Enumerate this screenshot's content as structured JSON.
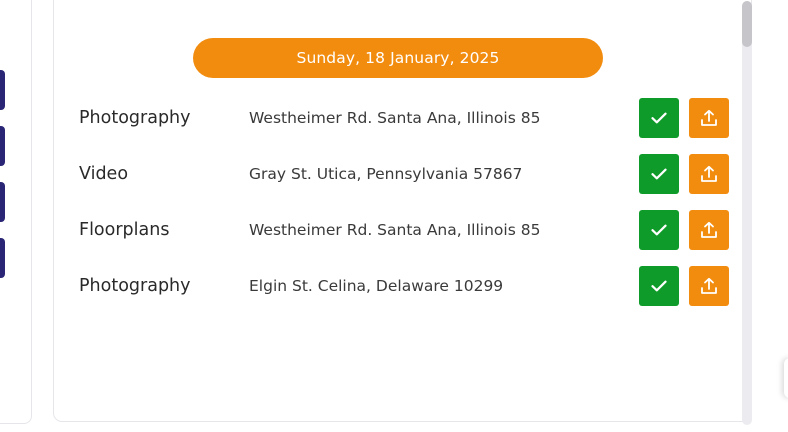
{
  "header": {
    "date": "Sunday, 18 January, 2025"
  },
  "rows": [
    {
      "service": "Photography",
      "address": "Westheimer Rd. Santa Ana, Illinois 85"
    },
    {
      "service": "Video",
      "address": "Gray St. Utica, Pennsylvania 57867"
    },
    {
      "service": "Floorplans",
      "address": "Westheimer Rd. Santa Ana, Illinois 85"
    },
    {
      "service": "Photography",
      "address": "Elgin St. Celina, Delaware 10299"
    }
  ],
  "colors": {
    "accent_orange": "#f28c0f",
    "confirm_green": "#0f9b2a",
    "sidebar_tab_navy": "#2a2575"
  },
  "icons": {
    "confirm": "check-icon",
    "upload": "upload-icon"
  }
}
